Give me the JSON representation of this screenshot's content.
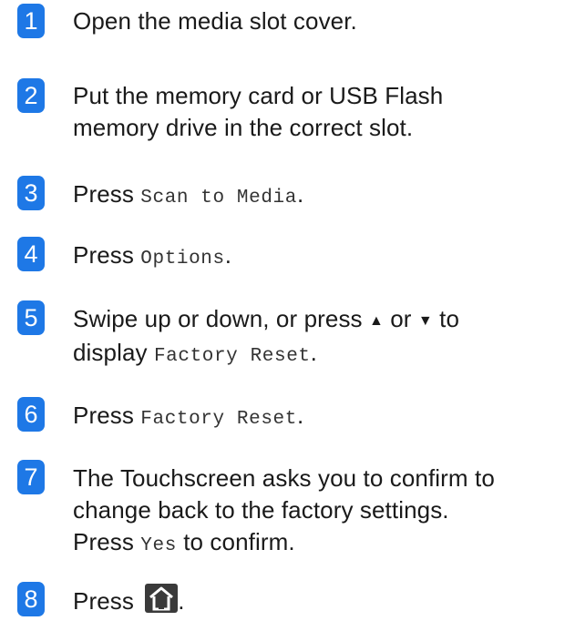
{
  "steps": [
    {
      "num": "1",
      "text": "Open the media slot cover."
    },
    {
      "num": "2",
      "line1": "Put the memory card or USB Flash",
      "line2": "memory drive in the correct slot."
    },
    {
      "num": "3",
      "pre": "Press ",
      "code": "Scan to Media",
      "post": "."
    },
    {
      "num": "4",
      "pre": "Press ",
      "code": "Options",
      "post": "."
    },
    {
      "num": "5",
      "l1_pre": "Swipe up or down, or press ",
      "up_arrow": "▲",
      "l1_mid": " or ",
      "down_arrow": "▼",
      "l1_post": " to",
      "l2_pre": "display ",
      "code": "Factory Reset",
      "post": "."
    },
    {
      "num": "6",
      "pre": "Press ",
      "code": "Factory Reset",
      "post": "."
    },
    {
      "num": "7",
      "line1": "The Touchscreen asks you to confirm to",
      "line2": "change back to the factory settings.",
      "l3_pre": "Press ",
      "code": "Yes",
      "post": " to confirm."
    },
    {
      "num": "8",
      "pre": "Press ",
      "icon": "home-icon",
      "post": "."
    }
  ],
  "colors": {
    "badge": "#1e78e6",
    "text": "#1a1a1a"
  }
}
